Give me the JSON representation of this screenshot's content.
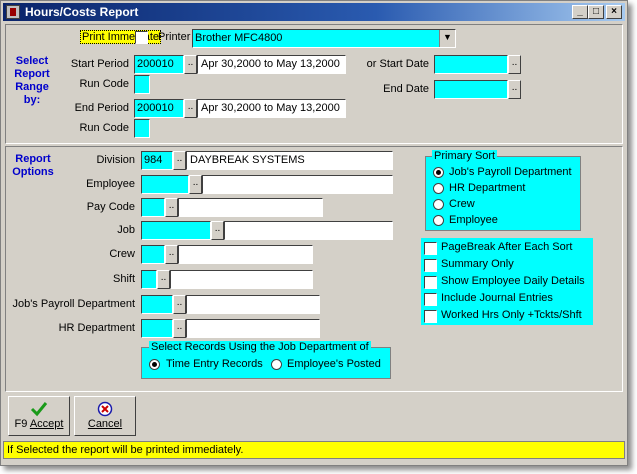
{
  "window": {
    "title": "Hours/Costs Report"
  },
  "print": {
    "immediate_label": "Print Immediate",
    "printer_label": "Printer",
    "printer_value": "Brother MFC4800"
  },
  "range": {
    "section_label": "Select Report Range by:",
    "start_period_label": "Start Period",
    "start_period_code": "200010",
    "start_period_text": "Apr 30,2000 to May 13,2000",
    "run_code_label": "Run Code",
    "end_period_label": "End Period",
    "end_period_code": "200010",
    "end_period_text": "Apr 30,2000 to May 13,2000",
    "or_start_date_label": "or Start Date",
    "end_date_label": "End Date"
  },
  "options": {
    "section_label": "Report Options",
    "division_label": "Division",
    "division_code": "984",
    "division_name": "DAYBREAK SYSTEMS",
    "employee_label": "Employee",
    "pay_code_label": "Pay Code",
    "job_label": "Job",
    "crew_label": "Crew",
    "shift_label": "Shift",
    "jobs_payroll_dept_label": "Job's Payroll Department",
    "hr_dept_label": "HR Department"
  },
  "primary_sort": {
    "title": "Primary Sort",
    "options": [
      "Job's Payroll Department",
      "HR Department",
      "Crew",
      "Employee"
    ]
  },
  "flags": {
    "items": [
      "PageBreak After Each Sort",
      "Summary Only",
      "Show Employee Daily Details",
      "Include Journal Entries",
      "Worked Hrs Only +Tckts/Shft"
    ]
  },
  "select_records": {
    "title": "Select Records Using the Job Department of",
    "option1": "Time Entry Records",
    "option2": "Employee's Posted"
  },
  "buttons": {
    "accept_key": "F9",
    "accept_label": "Accept",
    "cancel_label": "Cancel"
  },
  "status_text": "If Selected the report will be printed immediately.",
  "colors": {
    "field": "#00ffff",
    "status": "#ffff00",
    "label": "#0000cc",
    "title_bar": "#0a246a"
  }
}
